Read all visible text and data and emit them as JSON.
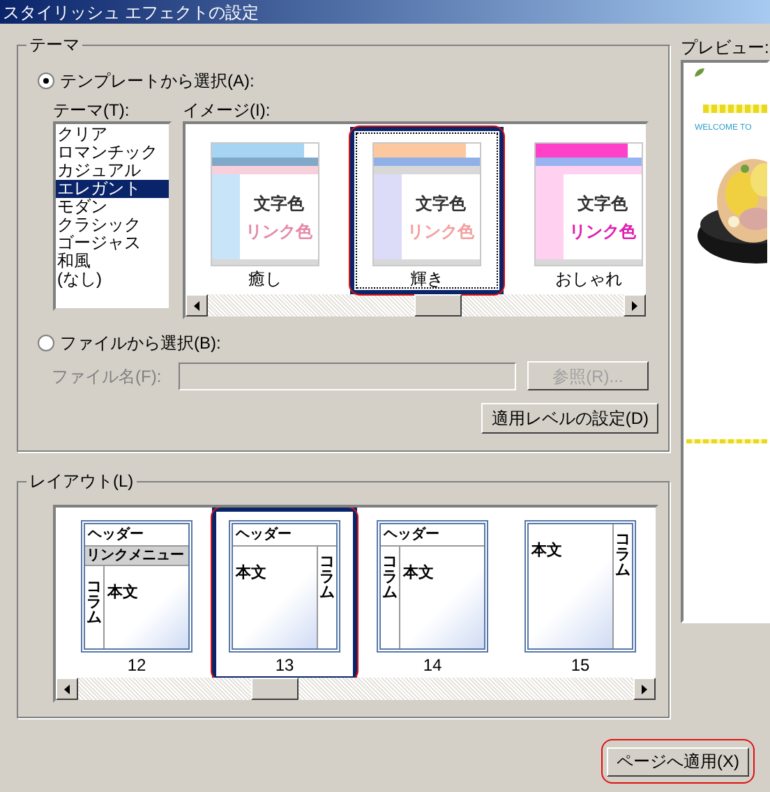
{
  "window": {
    "title": "スタイリッシュ エフェクトの設定"
  },
  "theme_group": {
    "title": "テーマ",
    "template_option": {
      "label": "テンプレートから選択(A):",
      "selected": true
    },
    "theme_list": {
      "label": "テーマ(T):",
      "items": [
        {
          "label": "クリア",
          "selected": false
        },
        {
          "label": "ロマンチック",
          "selected": false
        },
        {
          "label": "カジュアル",
          "selected": false
        },
        {
          "label": "エレガント",
          "selected": true
        },
        {
          "label": "モダン",
          "selected": false
        },
        {
          "label": "クラシック",
          "selected": false
        },
        {
          "label": "ゴージャス",
          "selected": false
        },
        {
          "label": "和風",
          "selected": false
        },
        {
          "label": "(なし)",
          "selected": false
        }
      ]
    },
    "image_list": {
      "label": "イメージ(I):",
      "items": [
        {
          "kind": "soft",
          "label": "癒し",
          "selected": false,
          "color": "#e48aaa",
          "text_label": "文字色",
          "link_label": "リンク色"
        },
        {
          "kind": "shine",
          "label": "輝き",
          "selected": true,
          "color": "#f4a0a0",
          "text_label": "文字色",
          "link_label": "リンク色"
        },
        {
          "kind": "stylish",
          "label": "おしゃれ",
          "selected": false,
          "color": "#e020b0",
          "text_label": "文字色",
          "link_label": "リンク色"
        }
      ]
    },
    "file_option": {
      "label": "ファイルから選択(B):",
      "selected": false
    },
    "file_name": {
      "label": "ファイル名(F):",
      "disabled": true
    },
    "browse_button": {
      "label": "参照(R)...",
      "disabled": true
    },
    "level_button": "適用レベルの設定(D)"
  },
  "preview": {
    "label": "プレビュー:",
    "heading": "WELCOME TO"
  },
  "layout_group": {
    "title": "レイアウト(L)",
    "items": [
      {
        "kind": "menu-left",
        "number": "12",
        "selected": false,
        "header": "ヘッダー",
        "menu": "リンクメニュー",
        "body": "本文",
        "column": "コラム"
      },
      {
        "kind": "right",
        "number": "13",
        "selected": true,
        "header": "ヘッダー",
        "body": "本文",
        "column": "コラム"
      },
      {
        "kind": "left",
        "number": "14",
        "selected": false,
        "header": "ヘッダー",
        "body": "本文",
        "column": "コラム"
      },
      {
        "kind": "noheader-right",
        "number": "15",
        "selected": false,
        "body": "本文",
        "column": "コラム"
      }
    ]
  },
  "apply_button": "ページへ適用(X)"
}
